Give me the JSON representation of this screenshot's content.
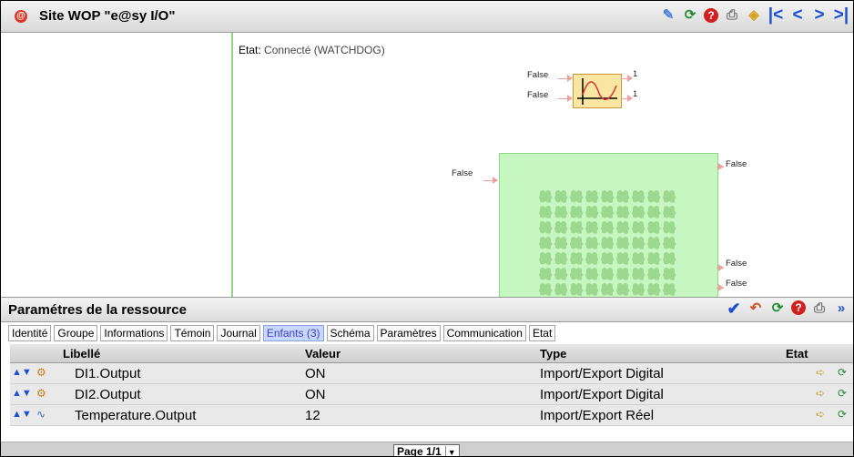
{
  "titlebar": {
    "title": "Site WOP \"e@sy I/O\"",
    "icons": [
      "pencil-icon",
      "refresh-icon",
      "help-icon",
      "print-icon",
      "export-icon",
      "first-page-icon",
      "prev-icon",
      "next-icon",
      "last-page-icon"
    ]
  },
  "diagram": {
    "etat_label": "Etat:",
    "etat_value": " Connecté (WATCHDOG)",
    "func_inputs": [
      "False",
      "False"
    ],
    "func_outputs": [
      "1",
      "1"
    ],
    "block_input": "False",
    "block_outputs": [
      "False",
      "False",
      "False"
    ]
  },
  "params": {
    "title": "Paramétres de la ressource",
    "tabs": [
      "Identité",
      "Groupe",
      "Informations",
      "Témoin",
      "Journal",
      "Enfants (3)",
      "Schéma",
      "Paramètres",
      "Communication",
      "Etat"
    ],
    "active_tab": "Enfants (3)",
    "columns": {
      "libelle": "Libellé",
      "valeur": "Valeur",
      "type": "Type",
      "etat": "Etat"
    },
    "rows": [
      {
        "libelle": "DI1.Output",
        "valeur": "ON",
        "type": "Import/Export Digital"
      },
      {
        "libelle": "DI2.Output",
        "valeur": "ON",
        "type": "Import/Export Digital"
      },
      {
        "libelle": "Temperature.Output",
        "valeur": "12",
        "type": "Import/Export Réel"
      }
    ],
    "page": "Page 1/1"
  },
  "colors": {
    "accent": "#1d4fd1",
    "block_green": "#c6f7c0",
    "func_yellow": "#f9e6a3",
    "tab_active": "#c7d7ff"
  }
}
